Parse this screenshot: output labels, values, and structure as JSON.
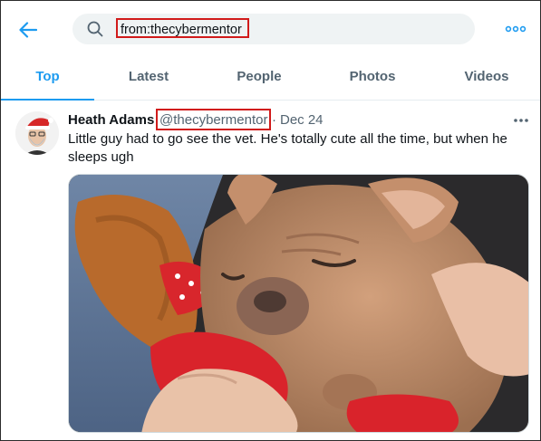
{
  "header": {
    "back_icon": "arrow-left-icon",
    "search": {
      "icon": "search-icon",
      "query": "from:thecybermentor"
    },
    "more_icon": "more-horizontal-icon"
  },
  "tabs": [
    {
      "label": "Top",
      "active": true
    },
    {
      "label": "Latest",
      "active": false
    },
    {
      "label": "People",
      "active": false
    },
    {
      "label": "Photos",
      "active": false
    },
    {
      "label": "Videos",
      "active": false
    }
  ],
  "tweet": {
    "author_name": "Heath Adams",
    "handle": "@thecybermentor",
    "separator": "·",
    "date": "Dec 24",
    "text": "Little guy had to go see the vet. He's totally cute all the time, but when he sleeps ugh",
    "more_icon": "more-horizontal-icon",
    "media_description_icon": "photo-puppy"
  },
  "colors": {
    "accent": "#1d9bf0",
    "highlight_box": "#d11b1b",
    "muted_text": "#536471"
  }
}
